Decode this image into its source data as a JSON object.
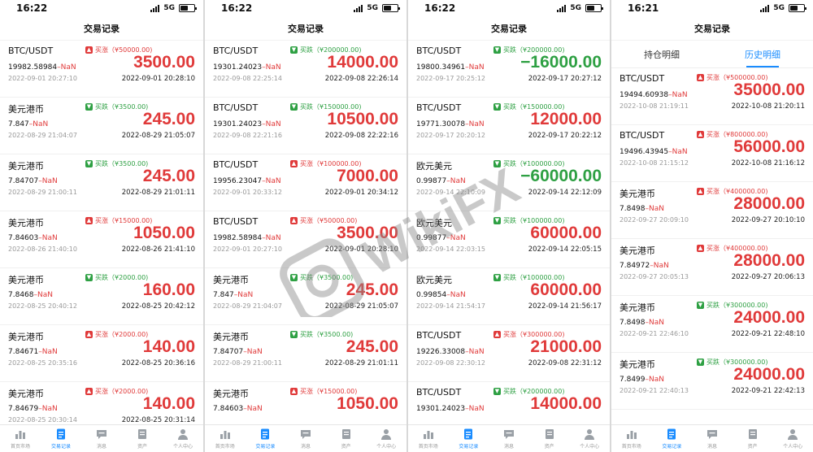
{
  "colors": {
    "up": "#e03a3a",
    "down": "#2ea043",
    "accent": "#1a8cff"
  },
  "bottom_nav": [
    {
      "label": "首页市场",
      "icon": "market-chart-icon"
    },
    {
      "label": "交易记录",
      "icon": "records-icon"
    },
    {
      "label": "消息",
      "icon": "message-icon"
    },
    {
      "label": "资产",
      "icon": "assets-icon"
    },
    {
      "label": "个人中心",
      "icon": "profile-icon"
    }
  ],
  "watermark": {
    "text": "WikiFX"
  },
  "panels": [
    {
      "time": "16:22",
      "network": "5G",
      "title": "交易记录",
      "tabs": [],
      "records": [
        {
          "symbol": "BTC/USDT",
          "direction": "up",
          "dir_label": "买涨（¥50000.00)",
          "price": "19982.58984",
          "nan": "–NaN",
          "open_time": "2022-09-01 20:27:10",
          "amount": "3500.00",
          "close_time": "2022-09-01 20:28:10"
        },
        {
          "symbol": "美元港币",
          "direction": "down",
          "dir_label": "买跌（¥3500.00)",
          "price": "7.847",
          "nan": "–NaN",
          "open_time": "2022-08-29 21:04:07",
          "amount": "245.00",
          "close_time": "2022-08-29 21:05:07"
        },
        {
          "symbol": "美元港币",
          "direction": "down",
          "dir_label": "买跌（¥3500.00)",
          "price": "7.84707",
          "nan": "–NaN",
          "open_time": "2022-08-29 21:00:11",
          "amount": "245.00",
          "close_time": "2022-08-29 21:01:11"
        },
        {
          "symbol": "美元港币",
          "direction": "up",
          "dir_label": "买涨（¥15000.00)",
          "price": "7.84603",
          "nan": "–NaN",
          "open_time": "2022-08-26 21:40:10",
          "amount": "1050.00",
          "close_time": "2022-08-26 21:41:10"
        },
        {
          "symbol": "美元港币",
          "direction": "down",
          "dir_label": "买跌（¥2000.00)",
          "price": "7.8468",
          "nan": "–NaN",
          "open_time": "2022-08-25 20:40:12",
          "amount": "160.00",
          "close_time": "2022-08-25 20:42:12"
        },
        {
          "symbol": "美元港币",
          "direction": "up",
          "dir_label": "买涨（¥2000.00)",
          "price": "7.84671",
          "nan": "–NaN",
          "open_time": "2022-08-25 20:35:16",
          "amount": "140.00",
          "close_time": "2022-08-25 20:36:16"
        },
        {
          "symbol": "美元港币",
          "direction": "up",
          "dir_label": "买涨（¥2000.00)",
          "price": "7.84679",
          "nan": "–NaN",
          "open_time": "2022-08-25 20:30:14",
          "amount": "140.00",
          "close_time": "2022-08-25 20:31:14"
        }
      ],
      "active_tab": 1
    },
    {
      "time": "16:22",
      "network": "5G",
      "title": "交易记录",
      "tabs": [],
      "records": [
        {
          "symbol": "BTC/USDT",
          "direction": "down",
          "dir_label": "买跌（¥200000.00)",
          "price": "19301.24023",
          "nan": "–NaN",
          "open_time": "2022-09-08 22:25:14",
          "amount": "14000.00",
          "close_time": "2022-09-08 22:26:14"
        },
        {
          "symbol": "BTC/USDT",
          "direction": "down",
          "dir_label": "买跌（¥150000.00)",
          "price": "19301.24023",
          "nan": "–NaN",
          "open_time": "2022-09-08 22:21:16",
          "amount": "10500.00",
          "close_time": "2022-09-08 22:22:16"
        },
        {
          "symbol": "BTC/USDT",
          "direction": "up",
          "dir_label": "买涨（¥100000.00)",
          "price": "19956.23047",
          "nan": "–NaN",
          "open_time": "2022-09-01 20:33:12",
          "amount": "7000.00",
          "close_time": "2022-09-01 20:34:12"
        },
        {
          "symbol": "BTC/USDT",
          "direction": "up",
          "dir_label": "买涨（¥50000.00)",
          "price": "19982.58984",
          "nan": "–NaN",
          "open_time": "2022-09-01 20:27:10",
          "amount": "3500.00",
          "close_time": "2022-09-01 20:28:10"
        },
        {
          "symbol": "美元港币",
          "direction": "down",
          "dir_label": "买跌（¥3500.00)",
          "price": "7.847",
          "nan": "–NaN",
          "open_time": "2022-08-29 21:04:07",
          "amount": "245.00",
          "close_time": "2022-08-29 21:05:07"
        },
        {
          "symbol": "美元港币",
          "direction": "down",
          "dir_label": "买跌（¥3500.00)",
          "price": "7.84707",
          "nan": "–NaN",
          "open_time": "2022-08-29 21:00:11",
          "amount": "245.00",
          "close_time": "2022-08-29 21:01:11"
        },
        {
          "symbol": "美元港币",
          "direction": "up",
          "dir_label": "买涨（¥15000.00)",
          "price": "7.84603",
          "nan": "–NaN",
          "open_time": "",
          "amount": "1050.00",
          "close_time": ""
        }
      ],
      "active_tab": 1
    },
    {
      "time": "16:22",
      "network": "5G",
      "title": "交易记录",
      "tabs": [],
      "records": [
        {
          "symbol": "BTC/USDT",
          "direction": "down",
          "dir_label": "买跌（¥200000.00)",
          "price": "19800.34961",
          "nan": "–NaN",
          "open_time": "2022-09-17 20:25:12",
          "amount": "−16000.00",
          "close_time": "2022-09-17 20:27:12"
        },
        {
          "symbol": "BTC/USDT",
          "direction": "down",
          "dir_label": "买跌（¥150000.00)",
          "price": "19771.30078",
          "nan": "–NaN",
          "open_time": "2022-09-17 20:20:12",
          "amount": "12000.00",
          "close_time": "2022-09-17 20:22:12"
        },
        {
          "symbol": "欧元美元",
          "direction": "down",
          "dir_label": "买跌（¥100000.00)",
          "price": "0.99877",
          "nan": "–NaN",
          "open_time": "2022-09-14 22:10:09",
          "amount": "−60000.00",
          "close_time": "2022-09-14 22:12:09"
        },
        {
          "symbol": "欧元美元",
          "direction": "down",
          "dir_label": "买跌（¥100000.00)",
          "price": "0.99877",
          "nan": "–NaN",
          "open_time": "2022-09-14 22:03:15",
          "amount": "60000.00",
          "close_time": "2022-09-14 22:05:15"
        },
        {
          "symbol": "欧元美元",
          "direction": "down",
          "dir_label": "买跌（¥100000.00)",
          "price": "0.99854",
          "nan": "–NaN",
          "open_time": "2022-09-14 21:54:17",
          "amount": "60000.00",
          "close_time": "2022-09-14 21:56:17"
        },
        {
          "symbol": "BTC/USDT",
          "direction": "up",
          "dir_label": "买涨（¥300000.00)",
          "price": "19226.33008",
          "nan": "–NaN",
          "open_time": "2022-09-08 22:30:12",
          "amount": "21000.00",
          "close_time": "2022-09-08 22:31:12"
        },
        {
          "symbol": "BTC/USDT",
          "direction": "down",
          "dir_label": "买跌（¥200000.00)",
          "price": "19301.24023",
          "nan": "–NaN",
          "open_time": "",
          "amount": "14000.00",
          "close_time": ""
        }
      ],
      "active_tab": 1
    },
    {
      "time": "16:21",
      "network": "5G",
      "title": "交易记录",
      "tabs": [
        "持仓明细",
        "历史明细"
      ],
      "records": [
        {
          "symbol": "BTC/USDT",
          "direction": "up",
          "dir_label": "买涨（¥500000.00)",
          "price": "19494.60938",
          "nan": "–NaN",
          "open_time": "2022-10-08 21:19:11",
          "amount": "35000.00",
          "close_time": "2022-10-08 21:20:11"
        },
        {
          "symbol": "BTC/USDT",
          "direction": "up",
          "dir_label": "买涨（¥800000.00)",
          "price": "19496.43945",
          "nan": "–NaN",
          "open_time": "2022-10-08 21:15:12",
          "amount": "56000.00",
          "close_time": "2022-10-08 21:16:12"
        },
        {
          "symbol": "美元港币",
          "direction": "up",
          "dir_label": "买涨（¥400000.00)",
          "price": "7.8498",
          "nan": "–NaN",
          "open_time": "2022-09-27 20:09:10",
          "amount": "28000.00",
          "close_time": "2022-09-27 20:10:10"
        },
        {
          "symbol": "美元港币",
          "direction": "up",
          "dir_label": "买涨（¥400000.00)",
          "price": "7.84972",
          "nan": "–NaN",
          "open_time": "2022-09-27 20:05:13",
          "amount": "28000.00",
          "close_time": "2022-09-27 20:06:13"
        },
        {
          "symbol": "美元港币",
          "direction": "down",
          "dir_label": "买跌（¥300000.00)",
          "price": "7.8498",
          "nan": "–NaN",
          "open_time": "2022-09-21 22:46:10",
          "amount": "24000.00",
          "close_time": "2022-09-21 22:48:10"
        },
        {
          "symbol": "美元港币",
          "direction": "down",
          "dir_label": "买跌（¥300000.00)",
          "price": "7.8499",
          "nan": "–NaN",
          "open_time": "2022-09-21 22:40:13",
          "amount": "24000.00",
          "close_time": "2022-09-21 22:42:13"
        }
      ],
      "active_tab": 1
    }
  ]
}
